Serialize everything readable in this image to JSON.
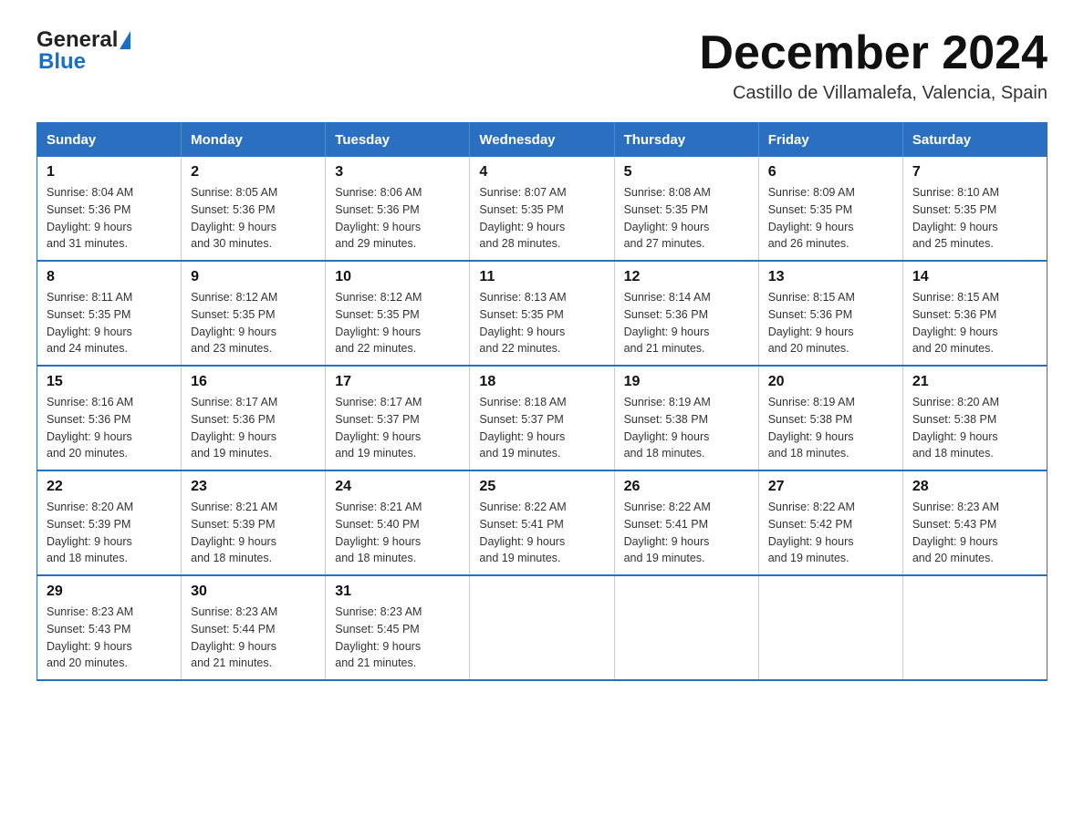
{
  "header": {
    "logo_general": "General",
    "logo_blue": "Blue",
    "month_title": "December 2024",
    "subtitle": "Castillo de Villamalefa, Valencia, Spain"
  },
  "days_of_week": [
    "Sunday",
    "Monday",
    "Tuesday",
    "Wednesday",
    "Thursday",
    "Friday",
    "Saturday"
  ],
  "weeks": [
    [
      {
        "day": "1",
        "sunrise": "8:04 AM",
        "sunset": "5:36 PM",
        "daylight": "9 hours and 31 minutes."
      },
      {
        "day": "2",
        "sunrise": "8:05 AM",
        "sunset": "5:36 PM",
        "daylight": "9 hours and 30 minutes."
      },
      {
        "day": "3",
        "sunrise": "8:06 AM",
        "sunset": "5:36 PM",
        "daylight": "9 hours and 29 minutes."
      },
      {
        "day": "4",
        "sunrise": "8:07 AM",
        "sunset": "5:35 PM",
        "daylight": "9 hours and 28 minutes."
      },
      {
        "day": "5",
        "sunrise": "8:08 AM",
        "sunset": "5:35 PM",
        "daylight": "9 hours and 27 minutes."
      },
      {
        "day": "6",
        "sunrise": "8:09 AM",
        "sunset": "5:35 PM",
        "daylight": "9 hours and 26 minutes."
      },
      {
        "day": "7",
        "sunrise": "8:10 AM",
        "sunset": "5:35 PM",
        "daylight": "9 hours and 25 minutes."
      }
    ],
    [
      {
        "day": "8",
        "sunrise": "8:11 AM",
        "sunset": "5:35 PM",
        "daylight": "9 hours and 24 minutes."
      },
      {
        "day": "9",
        "sunrise": "8:12 AM",
        "sunset": "5:35 PM",
        "daylight": "9 hours and 23 minutes."
      },
      {
        "day": "10",
        "sunrise": "8:12 AM",
        "sunset": "5:35 PM",
        "daylight": "9 hours and 22 minutes."
      },
      {
        "day": "11",
        "sunrise": "8:13 AM",
        "sunset": "5:35 PM",
        "daylight": "9 hours and 22 minutes."
      },
      {
        "day": "12",
        "sunrise": "8:14 AM",
        "sunset": "5:36 PM",
        "daylight": "9 hours and 21 minutes."
      },
      {
        "day": "13",
        "sunrise": "8:15 AM",
        "sunset": "5:36 PM",
        "daylight": "9 hours and 20 minutes."
      },
      {
        "day": "14",
        "sunrise": "8:15 AM",
        "sunset": "5:36 PM",
        "daylight": "9 hours and 20 minutes."
      }
    ],
    [
      {
        "day": "15",
        "sunrise": "8:16 AM",
        "sunset": "5:36 PM",
        "daylight": "9 hours and 20 minutes."
      },
      {
        "day": "16",
        "sunrise": "8:17 AM",
        "sunset": "5:36 PM",
        "daylight": "9 hours and 19 minutes."
      },
      {
        "day": "17",
        "sunrise": "8:17 AM",
        "sunset": "5:37 PM",
        "daylight": "9 hours and 19 minutes."
      },
      {
        "day": "18",
        "sunrise": "8:18 AM",
        "sunset": "5:37 PM",
        "daylight": "9 hours and 19 minutes."
      },
      {
        "day": "19",
        "sunrise": "8:19 AM",
        "sunset": "5:38 PM",
        "daylight": "9 hours and 18 minutes."
      },
      {
        "day": "20",
        "sunrise": "8:19 AM",
        "sunset": "5:38 PM",
        "daylight": "9 hours and 18 minutes."
      },
      {
        "day": "21",
        "sunrise": "8:20 AM",
        "sunset": "5:38 PM",
        "daylight": "9 hours and 18 minutes."
      }
    ],
    [
      {
        "day": "22",
        "sunrise": "8:20 AM",
        "sunset": "5:39 PM",
        "daylight": "9 hours and 18 minutes."
      },
      {
        "day": "23",
        "sunrise": "8:21 AM",
        "sunset": "5:39 PM",
        "daylight": "9 hours and 18 minutes."
      },
      {
        "day": "24",
        "sunrise": "8:21 AM",
        "sunset": "5:40 PM",
        "daylight": "9 hours and 18 minutes."
      },
      {
        "day": "25",
        "sunrise": "8:22 AM",
        "sunset": "5:41 PM",
        "daylight": "9 hours and 19 minutes."
      },
      {
        "day": "26",
        "sunrise": "8:22 AM",
        "sunset": "5:41 PM",
        "daylight": "9 hours and 19 minutes."
      },
      {
        "day": "27",
        "sunrise": "8:22 AM",
        "sunset": "5:42 PM",
        "daylight": "9 hours and 19 minutes."
      },
      {
        "day": "28",
        "sunrise": "8:23 AM",
        "sunset": "5:43 PM",
        "daylight": "9 hours and 20 minutes."
      }
    ],
    [
      {
        "day": "29",
        "sunrise": "8:23 AM",
        "sunset": "5:43 PM",
        "daylight": "9 hours and 20 minutes."
      },
      {
        "day": "30",
        "sunrise": "8:23 AM",
        "sunset": "5:44 PM",
        "daylight": "9 hours and 21 minutes."
      },
      {
        "day": "31",
        "sunrise": "8:23 AM",
        "sunset": "5:45 PM",
        "daylight": "9 hours and 21 minutes."
      },
      null,
      null,
      null,
      null
    ]
  ],
  "labels": {
    "sunrise": "Sunrise:",
    "sunset": "Sunset:",
    "daylight": "Daylight:"
  }
}
